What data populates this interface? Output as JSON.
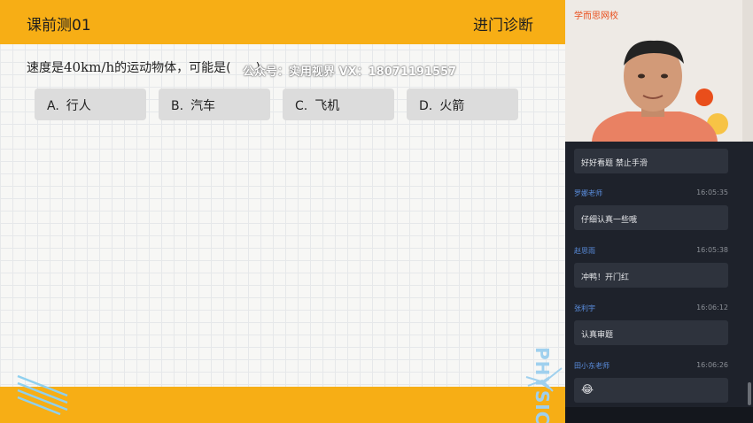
{
  "slide": {
    "lesson_title": "课前测01",
    "section_title": "进门诊断",
    "question_prefix": "速度是",
    "question_value": "40km/h",
    "question_suffix": "的运动物体，可能是(　　)",
    "options": [
      {
        "letter": "A.",
        "text": "行人"
      },
      {
        "letter": "B.",
        "text": "汽车"
      },
      {
        "letter": "C.",
        "text": "飞机"
      },
      {
        "letter": "D.",
        "text": "火箭"
      }
    ],
    "watermark": "公众号：实用视界 VX：18071191557",
    "subject_deco": "PHYSICS"
  },
  "webcam": {
    "brand": "学而思网校"
  },
  "chat": {
    "messages": [
      {
        "name": "",
        "time": "",
        "text": "好好看题 禁止手滑"
      },
      {
        "name": "罗娜老师",
        "time": "16:05:35",
        "text": "仔细认真一些哦"
      },
      {
        "name": "赵思雨",
        "time": "16:05:38",
        "text": "冲鸭！开门红"
      },
      {
        "name": "张利宇",
        "time": "16:06:12",
        "text": "认真审题"
      },
      {
        "name": "田小东老师",
        "time": "16:06:26",
        "text": "😂"
      }
    ]
  },
  "colors": {
    "header": "#f7ae15",
    "chat_bg": "#1e222b",
    "bubble": "#2e333d",
    "name": "#5b8fe0"
  }
}
